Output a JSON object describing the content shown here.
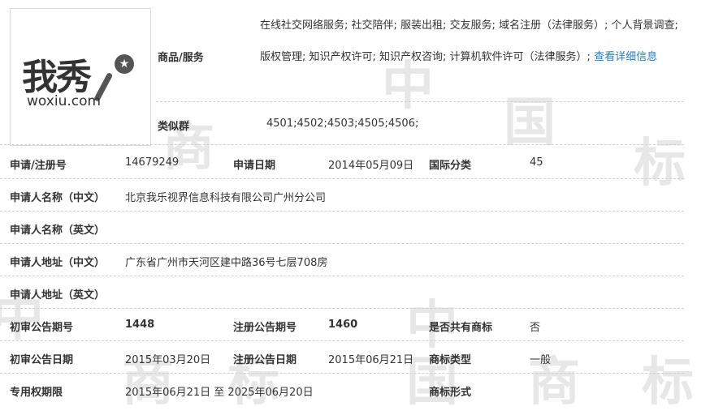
{
  "watermark": {
    "chars": [
      "中",
      "国",
      "商",
      "标"
    ]
  },
  "logo": {
    "cn_text": "我秀",
    "en_text": "woxiu.com",
    "icon": "microphone-icon"
  },
  "goods": {
    "label": "商品/服务",
    "text": "在线社交网络服务; 社交陪伴; 服装出租; 交友服务; 域名注册（法律服务）; 个人背景调查; 版权管理; 知识产权许可; 知识产权咨询; 计算机软件许可（法律服务）; ",
    "link": "查看详细信息"
  },
  "similar_group": {
    "label": "类似群",
    "value": "4501;4502;4503;4505;4506;"
  },
  "application_no": {
    "label": "申请/注册号",
    "value": "14679249"
  },
  "application_date": {
    "label": "申请日期",
    "value": "2014年05月09日"
  },
  "intl_class": {
    "label": "国际分类",
    "value": "45"
  },
  "applicant_name_cn": {
    "label": "申请人名称（中文）",
    "value": "北京我乐视界信息科技有限公司广州分公司"
  },
  "applicant_name_en": {
    "label": "申请人名称（英文）",
    "value": ""
  },
  "applicant_addr_cn": {
    "label": "申请人地址（中文）",
    "value": "广东省广州市天河区建中路36号七层708房"
  },
  "applicant_addr_en": {
    "label": "申请人地址（英文）",
    "value": ""
  },
  "prelim_issue": {
    "label": "初审公告期号",
    "value": "1448"
  },
  "reg_issue": {
    "label": "注册公告期号",
    "value": "1460"
  },
  "shared": {
    "label": "是否共有商标",
    "value": "否"
  },
  "prelim_date": {
    "label": "初审公告日期",
    "value": "2015年03月20日"
  },
  "reg_date": {
    "label": "注册公告日期",
    "value": "2015年06月21日"
  },
  "mark_type": {
    "label": "商标类型",
    "value": "一般"
  },
  "exclusive_period": {
    "label": "专用权期限",
    "value": "2015年06月21日 至 2025年06月20日"
  },
  "mark_form": {
    "label": "商标形式",
    "value": ""
  }
}
